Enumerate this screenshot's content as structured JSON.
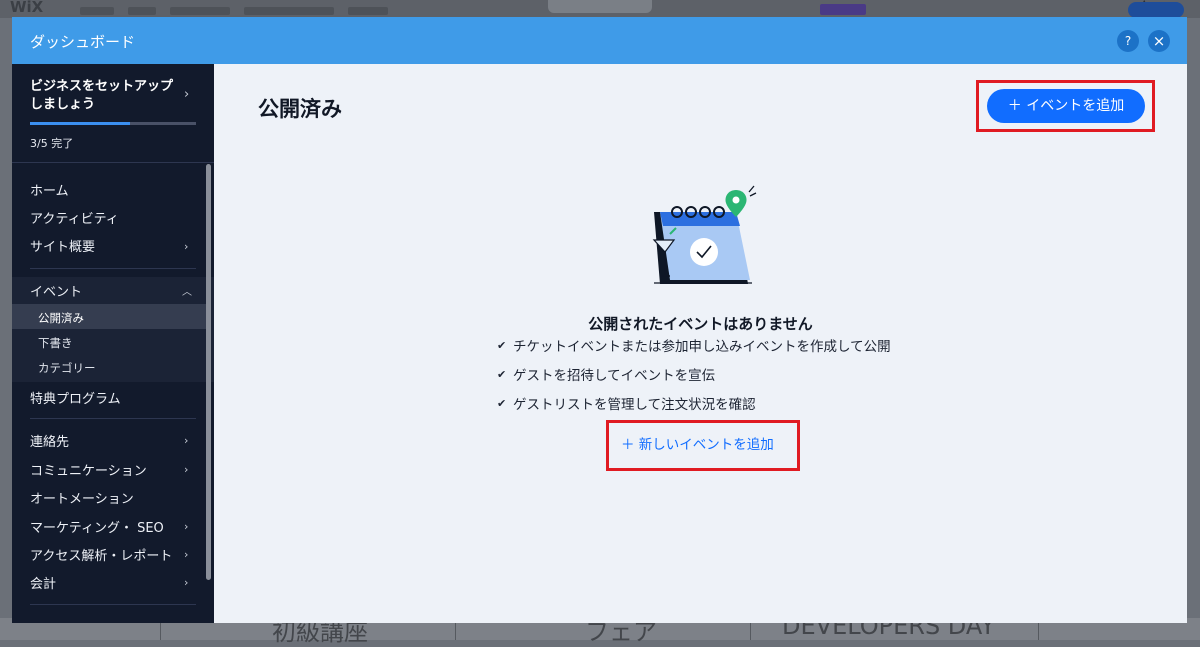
{
  "background": {
    "logo": "WiX",
    "bottom_texts": [
      "初級講座",
      "フェア",
      "DEVELOPERS DAY"
    ]
  },
  "header": {
    "title": "ダッシュボード",
    "help_label": "?",
    "close_label": "×"
  },
  "sidebar": {
    "setup_title": "ビジネスをセットアップしましょう",
    "progress_label": "3/5 完了",
    "progress_fraction": 0.6,
    "items": [
      {
        "label": "ホーム"
      },
      {
        "label": "アクティビティ"
      },
      {
        "label": "サイト概要"
      },
      {
        "label": "イベント"
      },
      {
        "label": "公開済み"
      },
      {
        "label": "下書き"
      },
      {
        "label": "カテゴリー"
      },
      {
        "label": "特典プログラム"
      },
      {
        "label": "連絡先"
      },
      {
        "label": "コミュニケーション"
      },
      {
        "label": "オートメーション"
      },
      {
        "label": "マーケティング・ SEO"
      },
      {
        "label": "アクセス解析・レポート"
      },
      {
        "label": "会計"
      }
    ]
  },
  "main": {
    "page_title": "公開済み",
    "add_button_label": "＋  イベントを追加",
    "empty_title": "公開されたイベントはありません",
    "checklist": [
      "チケットイベントまたは参加申し込みイベントを作成して公開",
      "ゲストを招待してイベントを宣伝",
      "ゲストリストを管理して注文状況を確認"
    ],
    "new_event_link": "＋  新しいイベントを追加"
  },
  "colors": {
    "header_blue": "#3f9be8",
    "sidebar_navy": "#121a2c",
    "primary_blue": "#116dff",
    "highlight_red": "#e01b22"
  }
}
